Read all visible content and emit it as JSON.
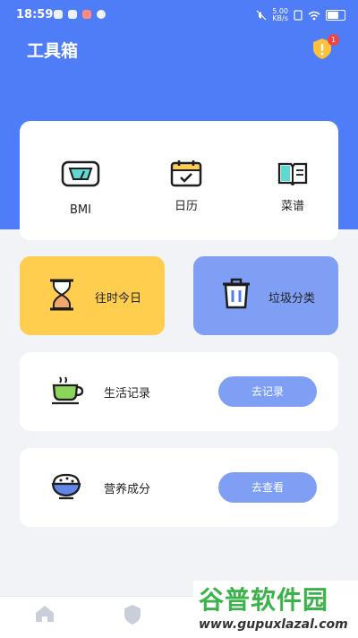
{
  "status_bar": {
    "time": "18:59",
    "speed_top": "5.00",
    "speed_bottom": "KB/s"
  },
  "header": {
    "title": "工具箱",
    "badge_count": "1"
  },
  "tools": [
    {
      "label": "BMI"
    },
    {
      "label": "日历"
    },
    {
      "label": "菜谱"
    }
  ],
  "tiles": {
    "past_today": {
      "label": "往时今日"
    },
    "garbage": {
      "label": "垃圾分类"
    }
  },
  "rows": {
    "life_record": {
      "label": "生活记录",
      "button": "去记录"
    },
    "nutrition": {
      "label": "营养成分",
      "button": "去查看"
    }
  },
  "watermark": {
    "title": "谷普软件园",
    "url": "www.gupuxlazal.com"
  },
  "colors": {
    "accent": "#4f7df7",
    "tile_yellow": "#ffce4e",
    "tile_blue": "#7f9ff5"
  }
}
